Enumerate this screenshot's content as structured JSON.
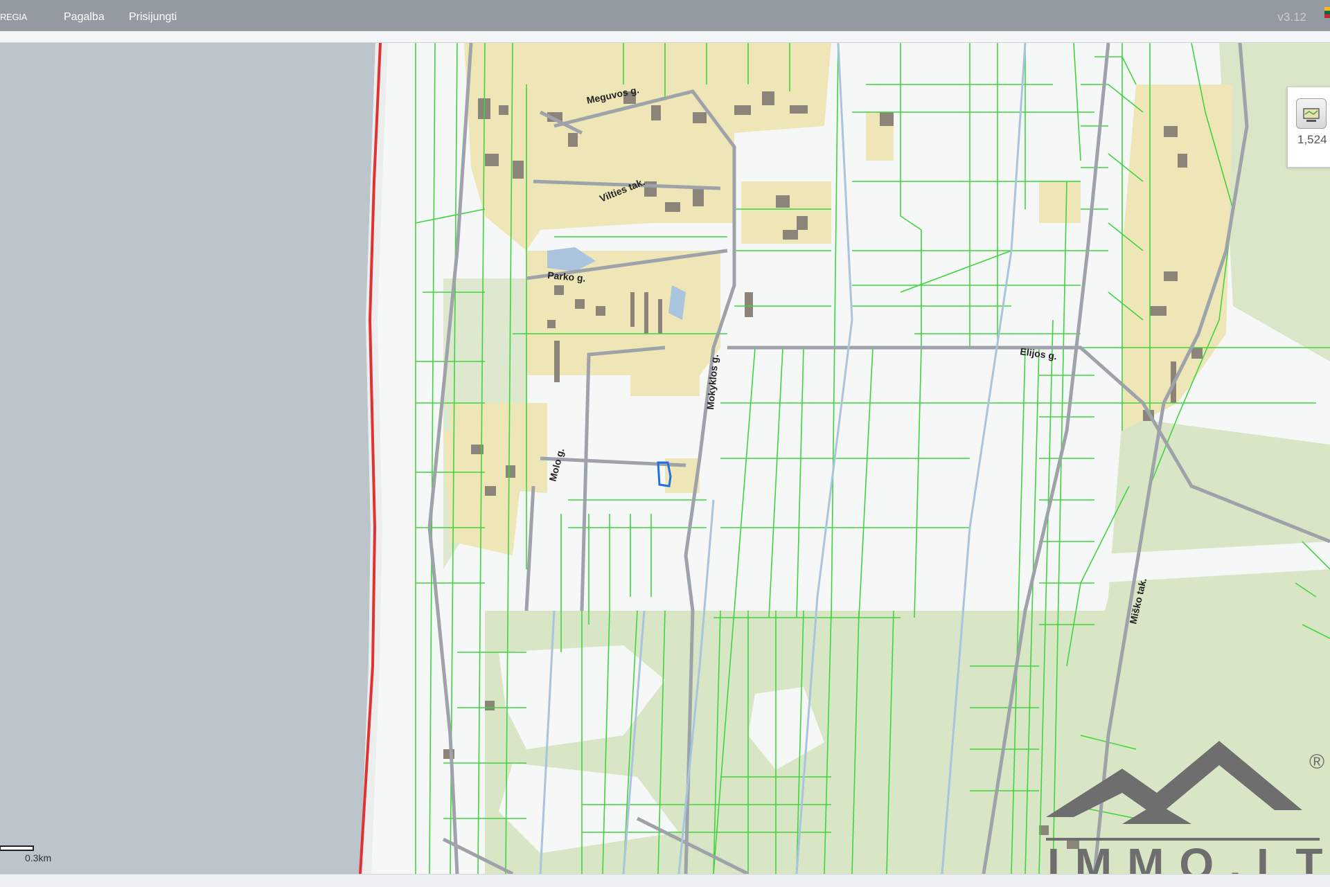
{
  "topbar": {
    "brand": "REGIA",
    "menu": [
      {
        "label": "Pagalba"
      },
      {
        "label": "Prisijungti"
      }
    ],
    "version": "v3.12"
  },
  "map": {
    "scalebar_label": "0.3km",
    "streets": {
      "meguvos": "Meguvos g.",
      "vilties": "Vilties tak.",
      "parko": "Parko g.",
      "mokyklos": "Mokyklos g.",
      "elijos": "Elijos g.",
      "molo": "Molo g.",
      "misko": "Miško tak."
    }
  },
  "widget": {
    "value": "1,524",
    "icon": "map-layers-icon"
  },
  "watermark": {
    "text": "IMMO.LT",
    "registered": "®"
  }
}
